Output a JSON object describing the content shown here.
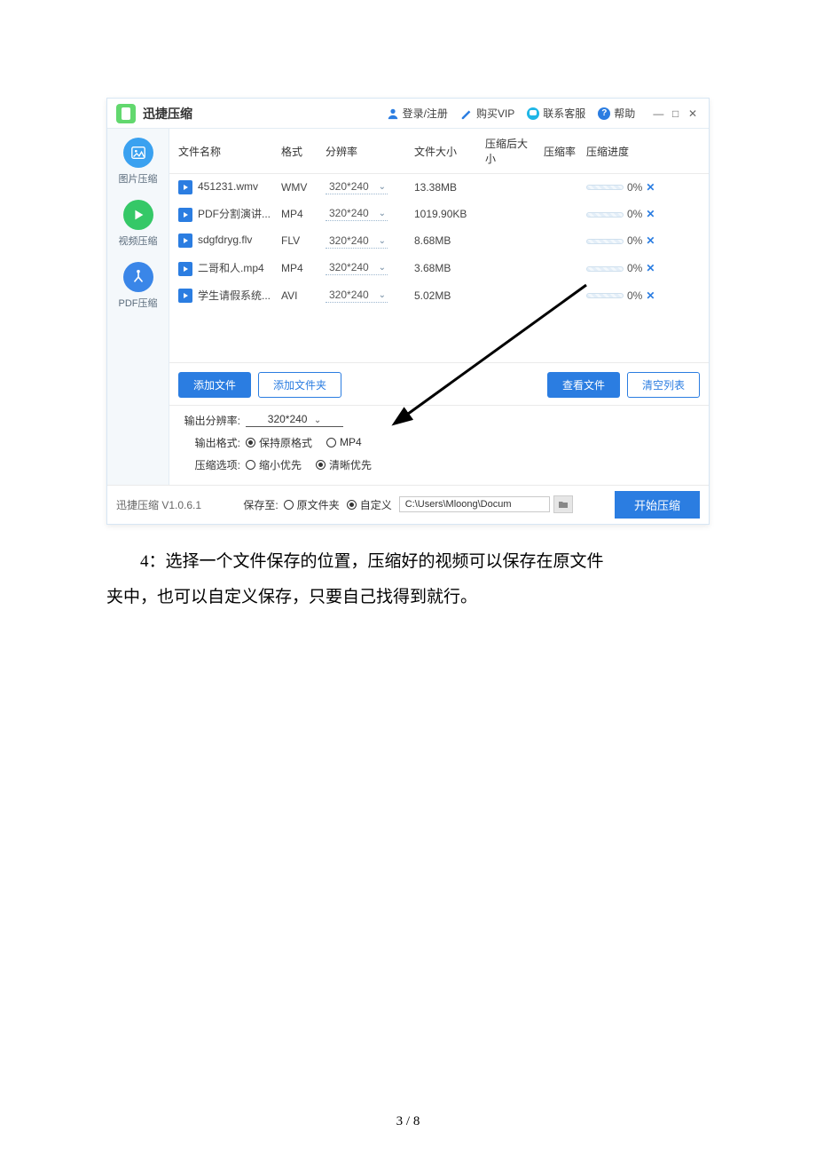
{
  "app": {
    "title": "迅捷压缩",
    "login": "登录/注册",
    "buy_vip": "购买VIP",
    "contact": "联系客服",
    "help": "帮助",
    "help_icon_text": "?",
    "min": "—",
    "max": "□",
    "close": "✕"
  },
  "sidebar": {
    "items": [
      {
        "label": "图片压缩"
      },
      {
        "label": "视频压缩"
      },
      {
        "label": "PDF压缩"
      }
    ]
  },
  "table": {
    "headers": {
      "name": "文件名称",
      "format": "格式",
      "resolution": "分辨率",
      "size": "文件大小",
      "after_size": "压缩后大小",
      "rate": "压缩率",
      "progress": "压缩进度"
    },
    "rows": [
      {
        "name": "451231.wmv",
        "format": "WMV",
        "resolution": "320*240",
        "size": "13.38MB",
        "after": "",
        "rate": "",
        "pct": "0%"
      },
      {
        "name": "PDF分割演讲...",
        "format": "MP4",
        "resolution": "320*240",
        "size": "1019.90KB",
        "after": "",
        "rate": "",
        "pct": "0%"
      },
      {
        "name": "sdgfdryg.flv",
        "format": "FLV",
        "resolution": "320*240",
        "size": "8.68MB",
        "after": "",
        "rate": "",
        "pct": "0%"
      },
      {
        "name": "二哥和人.mp4",
        "format": "MP4",
        "resolution": "320*240",
        "size": "3.68MB",
        "after": "",
        "rate": "",
        "pct": "0%"
      },
      {
        "name": "学生请假系统...",
        "format": "AVI",
        "resolution": "320*240",
        "size": "5.02MB",
        "after": "",
        "rate": "",
        "pct": "0%"
      }
    ]
  },
  "actions": {
    "add_file": "添加文件",
    "add_folder": "添加文件夹",
    "view_file": "查看文件",
    "clear_list": "清空列表"
  },
  "settings": {
    "out_res_label": "输出分辨率:",
    "out_res_value": "320*240",
    "out_fmt_label": "输出格式:",
    "out_fmt_keep": "保持原格式",
    "out_fmt_mp4": "MP4",
    "comp_opt_label": "压缩选项:",
    "comp_small": "缩小优先",
    "comp_clear": "清晰优先"
  },
  "footer": {
    "version": "迅捷压缩 V1.0.6.1",
    "save_to": "保存至:",
    "save_orig": "原文件夹",
    "save_custom": "自定义",
    "path": "C:\\Users\\Mloong\\Docum",
    "start": "开始压缩"
  },
  "doc": {
    "step_no": "4：",
    "line1": "选择一个文件保存的位置，压缩好的视频可以保存在原文件",
    "line2": "夹中，也可以自定义保存，只要自己找得到就行。"
  },
  "page_num": "3 / 8",
  "glyphs": {
    "chev": "﹀",
    "chev_small": "⌄",
    "x": "✕"
  }
}
